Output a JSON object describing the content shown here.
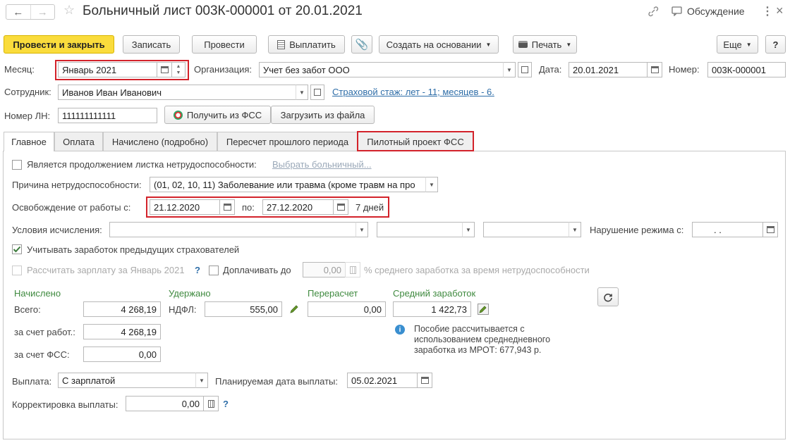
{
  "window": {
    "title": "Больничный лист 003К-000001 от 20.01.2021",
    "discussion_label": "Обсуждение"
  },
  "toolbar": {
    "post_close": "Провести и закрыть",
    "save": "Записать",
    "post": "Провести",
    "pay": "Выплатить",
    "create_based": "Создать на основании",
    "print": "Печать",
    "more": "Еще",
    "help": "?"
  },
  "header": {
    "month_label": "Месяц:",
    "month_value": "Январь 2021",
    "org_label": "Организация:",
    "org_value": "Учет без забот ООО",
    "date_label": "Дата:",
    "date_value": "20.01.2021",
    "number_label": "Номер:",
    "number_value": "003К-000001",
    "employee_label": "Сотрудник:",
    "employee_value": "Иванов Иван Иванович",
    "insurance_link": "Страховой стаж: лет - 11; месяцев - 6.",
    "ln_label": "Номер ЛН:",
    "ln_value": "111111111111",
    "get_fss": "Получить из ФСС",
    "load_file": "Загрузить из файла"
  },
  "tabs": [
    {
      "label": "Главное"
    },
    {
      "label": "Оплата"
    },
    {
      "label": "Начислено (подробно)"
    },
    {
      "label": "Пересчет прошлого периода"
    },
    {
      "label": "Пилотный проект ФСС"
    }
  ],
  "main": {
    "continuation_label": "Является продолжением листка нетрудоспособности:",
    "choose_sick_link": "Выбрать больничный...",
    "cause_label": "Причина нетрудоспособности:",
    "cause_value": "(01, 02, 10, 11) Заболевание или травма (кроме травм на про",
    "release_label": "Освобождение от работы с:",
    "release_from": "21.12.2020",
    "release_to_label": "по:",
    "release_to": "27.12.2020",
    "days": "7 дней",
    "conditions_label": "Условия исчисления:",
    "violation_label": "Нарушение режима с:",
    "violation_value": ".  .",
    "consider_prev_label": "Учитывать заработок предыдущих страхователей",
    "calc_salary_label": "Рассчитать зарплату за Январь 2021",
    "surcharge_label": "Доплачивать до",
    "surcharge_value": "0,00",
    "surcharge_suffix": "% среднего заработка за время нетрудоспособности",
    "accrued_header": "Начислено",
    "withheld_header": "Удержано",
    "recalc_header": "Перерасчет",
    "avg_header": "Средний заработок",
    "total_label": "Всего:",
    "total_value": "4 268,19",
    "ndfl_label": "НДФЛ:",
    "ndfl_value": "555,00",
    "recalc_value": "0,00",
    "avg_value": "1 422,73",
    "employer_label": "за счет работ.:",
    "employer_value": "4 268,19",
    "fss_label": "за счет ФСС:",
    "fss_value": "0,00",
    "info_text_1": "Пособие рассчитывается с",
    "info_text_2": "использованием среднедневного",
    "info_text_3": "заработка из МРОТ: 677,943 р.",
    "payment_label": "Выплата:",
    "payment_value": "С зарплатой",
    "planned_date_label": "Планируемая дата выплаты:",
    "planned_date_value": "05.02.2021",
    "correction_label": "Корректировка выплаты:",
    "correction_value": "0,00"
  }
}
